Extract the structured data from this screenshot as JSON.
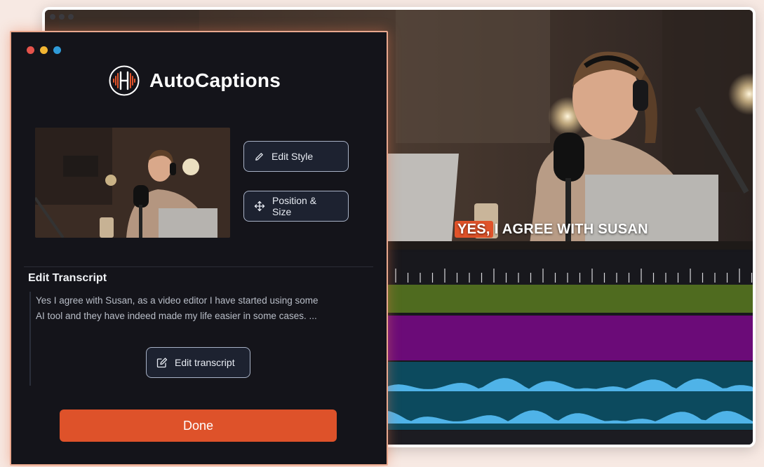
{
  "app": {
    "title": "AutoCaptions"
  },
  "window": {
    "dots": [
      "#e5534b",
      "#f2b532",
      "#2f9bd8"
    ]
  },
  "actions": {
    "edit_style": "Edit Style",
    "position_size": "Position & Size",
    "edit_transcript": "Edit transcript",
    "done": "Done"
  },
  "transcript": {
    "heading": "Edit Transcript",
    "line1": "Yes I agree with Susan, as a video editor I have started using some",
    "line2": "AI tool and they have indeed made my life easier in some cases. ..."
  },
  "preview": {
    "caption_highlight": "YES,",
    "caption_rest": "I AGREE WITH SUSAN"
  },
  "colors": {
    "accent": "#de522a",
    "track_video": "#4f6b1f",
    "track_caption": "#6b0b78",
    "track_audio": "#0c4a5e",
    "waveform": "#4fb3e8"
  }
}
